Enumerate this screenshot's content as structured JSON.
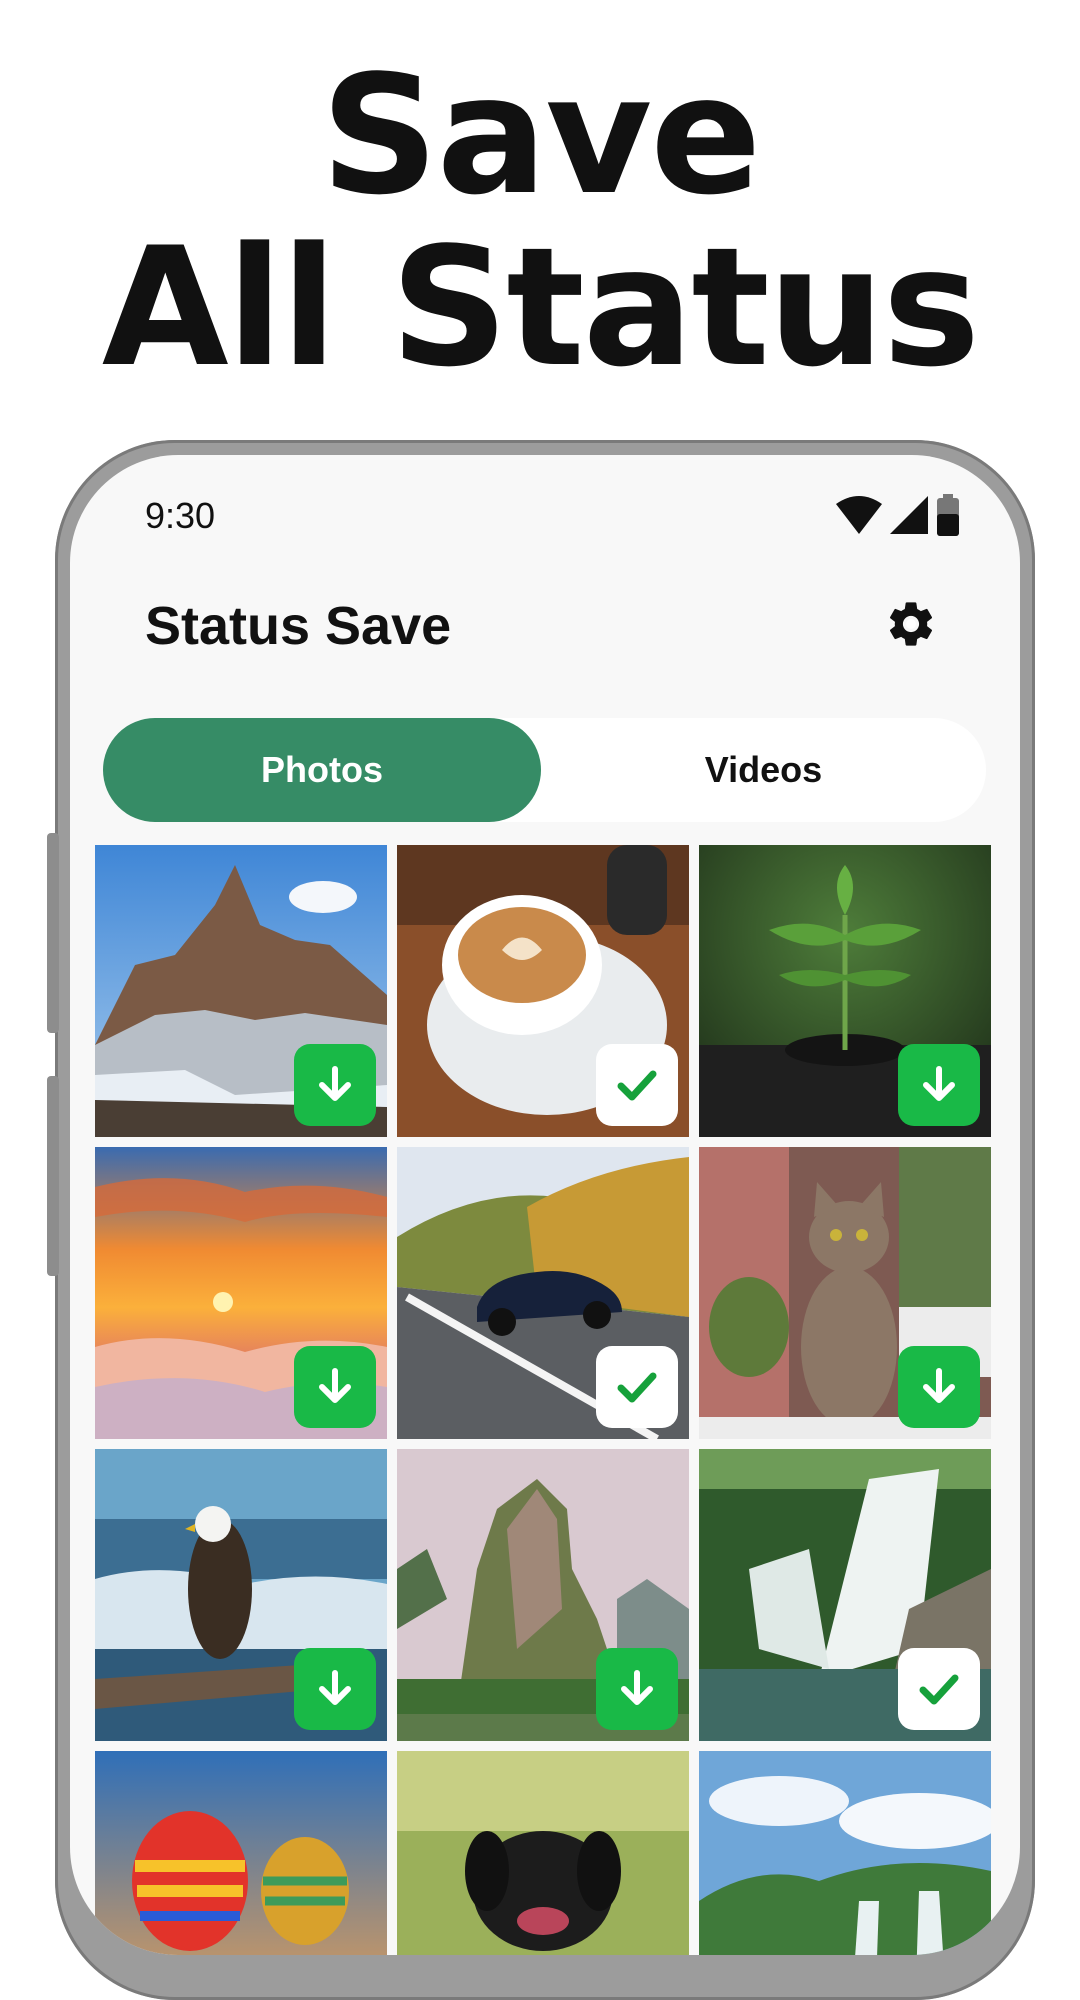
{
  "headline": {
    "line1": "Save",
    "line2": "All Status"
  },
  "status_bar": {
    "time": "9:30"
  },
  "app_bar": {
    "title": "Status Save",
    "settings_icon": "gear-icon"
  },
  "tabs": [
    {
      "label": "Photos",
      "selected": true
    },
    {
      "label": "Videos",
      "selected": false
    }
  ],
  "grid": [
    {
      "subject": "mountain",
      "state": "download"
    },
    {
      "subject": "coffee",
      "state": "saved"
    },
    {
      "subject": "sprout",
      "state": "download"
    },
    {
      "subject": "sunset",
      "state": "download"
    },
    {
      "subject": "car",
      "state": "saved"
    },
    {
      "subject": "cat",
      "state": "download"
    },
    {
      "subject": "eagle",
      "state": "download"
    },
    {
      "subject": "karst",
      "state": "download"
    },
    {
      "subject": "waterfall",
      "state": "saved"
    },
    {
      "subject": "balloons",
      "state": "none"
    },
    {
      "subject": "dog",
      "state": "none"
    },
    {
      "subject": "falls",
      "state": "none"
    }
  ],
  "colors": {
    "accent": "#368c66",
    "download_button": "#19b947",
    "check": "#16a13b",
    "background": "#f8f8f8"
  }
}
